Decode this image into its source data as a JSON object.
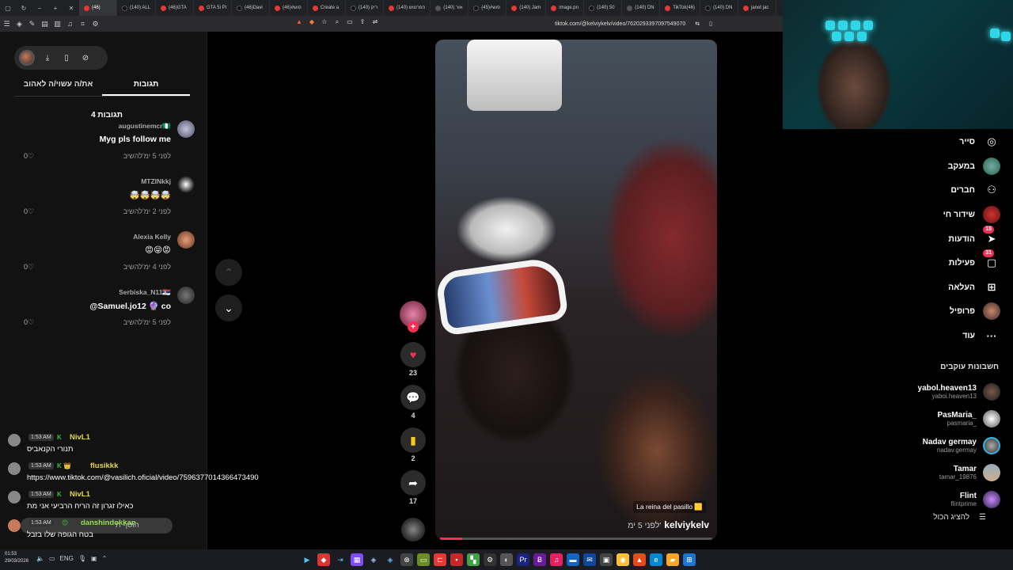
{
  "browser": {
    "tabs": [
      {
        "label": "(46)"
      },
      {
        "label": "(140) ALL"
      },
      {
        "label": "(46)GTA"
      },
      {
        "label": "GTA 5i Pl"
      },
      {
        "label": "(46)Davi"
      },
      {
        "label": "(46)#פוש"
      },
      {
        "label": "Create a"
      },
      {
        "label": "(140) ריק"
      },
      {
        "label": "(140) הפרטוש"
      },
      {
        "label": "(140) אור"
      },
      {
        "label": "(45)#פוש"
      },
      {
        "label": "(140) Jam"
      },
      {
        "label": "image.pn"
      },
      {
        "label": "(140) 50"
      },
      {
        "label": "(140) DN"
      },
      {
        "label": "TikTok(46)"
      },
      {
        "label": "(140) DN"
      },
      {
        "label": "janet jac"
      }
    ],
    "url": "tiktok.com/@kelviykelv/video/7620293397097549070"
  },
  "left_panel": {
    "tab_comments": "תגובות",
    "tab_you_may_like": "את/ה עשוי/ה לאהוב",
    "comment_count": "4 תגובות",
    "comments": [
      {
        "user": "augustinemcr🇳🇬",
        "text": "Myg pls follow me",
        "time": "לפני 5 ימ'",
        "reply": "להשיב",
        "likes": "0"
      },
      {
        "user": "MTZINkkj",
        "text": "🤯🤯🤯🤯",
        "time": "לפני 2 ימ'",
        "reply": "להשיב",
        "likes": "0"
      },
      {
        "user": "Alexia Kelly",
        "text": "😡😝😡",
        "time": "לפני 4 ימ'",
        "reply": "להשיב",
        "likes": "0"
      },
      {
        "user": "Serbiska_N11🇷🇸",
        "text": "@Samuel.jo12 🔮 co",
        "time": "לפני 5 ימ'",
        "reply": "להשיב",
        "likes": "0"
      }
    ]
  },
  "chat": [
    {
      "time": "1:53 AM",
      "name": "NivL1",
      "msg": "תנורי הקנאביס"
    },
    {
      "time": "1:53 AM",
      "name": "flusikkk",
      "msg": "https://www.tiktok.com/@vasilich.oficial/video/7596377014366473490"
    },
    {
      "time": "1:53 AM",
      "name": "NivL1",
      "msg": "כאילו זגרון זה הריח הרביעי אני מת"
    },
    {
      "time": "1:53 AM",
      "name": "danshindokkan",
      "msg": "בטח הגופה שלו בזבל",
      "input_placeholder": "הוסף ת"
    }
  ],
  "video": {
    "caption": "La reina del pasillo 🟨",
    "author": "kelviykelv",
    "posted": "לפני 5 ימ'",
    "progress": 0.08
  },
  "actions": {
    "likes": "23",
    "comments": "4",
    "saves": "2",
    "shares": "17"
  },
  "right_nav": [
    {
      "label": "סייר",
      "icon": "compass-icon",
      "badge": ""
    },
    {
      "label": "במעקב",
      "icon": "following-avatar-icon",
      "badge": ""
    },
    {
      "label": "חברים",
      "icon": "friends-icon",
      "badge": ""
    },
    {
      "label": "שידור חי",
      "icon": "live-icon",
      "badge": ""
    },
    {
      "label": "הודעות",
      "icon": "messages-icon",
      "badge": "15"
    },
    {
      "label": "פעילות",
      "icon": "activity-icon",
      "badge": "31"
    },
    {
      "label": "העלאה",
      "icon": "upload-icon",
      "badge": ""
    },
    {
      "label": "פרופיל",
      "icon": "profile-icon",
      "badge": ""
    },
    {
      "label": "עוד",
      "icon": "more-icon",
      "badge": ""
    }
  ],
  "following": {
    "title": "חשבונות עוקבים",
    "accounts": [
      {
        "name": "yabol.heaven13",
        "handle": "yaboi.heaven13"
      },
      {
        "name": "PasMaria_",
        "handle": "pasmaria_"
      },
      {
        "name": "Nadav germay",
        "handle": "nadav.germay"
      },
      {
        "name": "Tamar",
        "handle": "tamar_19876"
      },
      {
        "name": "Flint",
        "handle": "flintprime"
      }
    ],
    "show_all": "להציג הכול"
  },
  "taskbar": {
    "time": "01:53",
    "date": "29/03/2026",
    "lang": "ENG"
  }
}
